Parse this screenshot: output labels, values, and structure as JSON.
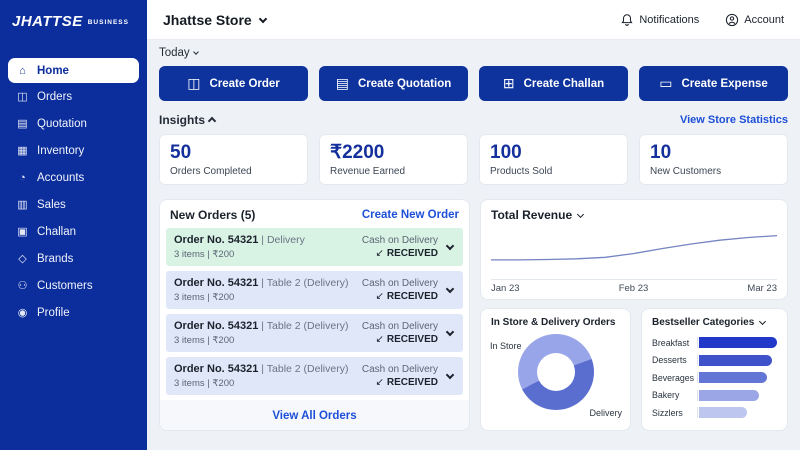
{
  "brand": {
    "logo_text": "JHATTSE",
    "logo_suffix": "BUSINESS"
  },
  "topbar": {
    "store_name": "Jhattse Store",
    "notifications_label": "Notifications",
    "account_label": "Account"
  },
  "sidebar": {
    "items": [
      {
        "label": "Home",
        "active": true
      },
      {
        "label": "Orders"
      },
      {
        "label": "Quotation"
      },
      {
        "label": "Inventory"
      },
      {
        "label": "Accounts"
      },
      {
        "label": "Sales"
      },
      {
        "label": "Challan"
      },
      {
        "label": "Brands"
      },
      {
        "label": "Customers"
      },
      {
        "label": "Profile"
      }
    ]
  },
  "icons": {
    "home": "⌂",
    "orders": "◫",
    "quotation": "▤",
    "inventory": "▦",
    "accounts": "◔",
    "sales": "▥",
    "challan": "▣",
    "brands": "◇",
    "customers": "⚇",
    "profile": "◉",
    "create_order": "◫",
    "create_quotation": "▤",
    "create_challan": "⊞",
    "create_expense": "▭"
  },
  "filters": {
    "period_label": "Today"
  },
  "actions": [
    {
      "label": "Create Order"
    },
    {
      "label": "Create Quotation"
    },
    {
      "label": "Create Challan"
    },
    {
      "label": "Create Expense"
    }
  ],
  "insights": {
    "title": "Insights",
    "stats_link": "View Store Statistics",
    "cards": [
      {
        "value": "50",
        "label": "Orders Completed"
      },
      {
        "value": "₹2200",
        "label": "Revenue Earned"
      },
      {
        "value": "100",
        "label": "Products Sold"
      },
      {
        "value": "10",
        "label": "New Customers"
      }
    ]
  },
  "new_orders": {
    "title": "New Orders (5)",
    "create_link": "Create New Order",
    "view_all": "View All Orders",
    "sep": "|",
    "status_arrow": "↙",
    "orders": [
      {
        "number": "Order No. 54321",
        "location": "Delivery",
        "items": "3 items | ₹200",
        "payment": "Cash on Delivery",
        "status": "RECEIVED",
        "highlight": "green"
      },
      {
        "number": "Order No. 54321",
        "location": "Table 2  (Delivery)",
        "items": "3 items | ₹200",
        "payment": "Cash on Delivery",
        "status": "RECEIVED",
        "highlight": "lavender"
      },
      {
        "number": "Order No. 54321",
        "location": "Table 2  (Delivery)",
        "items": "3 items | ₹200",
        "payment": "Cash on Delivery",
        "status": "RECEIVED",
        "highlight": "lavender"
      },
      {
        "number": "Order No. 54321",
        "location": "Table 2  (Delivery)",
        "items": "3 items | ₹200",
        "payment": "Cash on Delivery",
        "status": "RECEIVED",
        "highlight": "lavender"
      }
    ]
  },
  "chart_data": [
    {
      "type": "line",
      "title": "Total Revenue",
      "x_ticks": [
        "Jan 23",
        "Feb 23",
        "Mar 23"
      ],
      "x": [
        0,
        0.1,
        0.2,
        0.3,
        0.4,
        0.5,
        0.6,
        0.7,
        0.8,
        0.9,
        1
      ],
      "y": [
        16,
        16,
        17,
        19,
        23,
        33,
        46,
        58,
        68,
        75,
        80
      ],
      "note": "y values are relative 0-100; chart has no visible y-axis labels",
      "ylim": [
        0,
        100
      ],
      "color": "#7484c2",
      "grid": false,
      "legend": "none"
    },
    {
      "type": "pie",
      "title": "In Store & Delivery Orders",
      "labels": [
        "In Store",
        "Delivery"
      ],
      "values": [
        52,
        48
      ],
      "colors": [
        "#98a5e9",
        "#5a6ecf"
      ],
      "rotation_deg": 70,
      "donut": true
    },
    {
      "type": "bar",
      "orientation": "horizontal",
      "title": "Bestseller Categories",
      "categories": [
        "Breakfast",
        "Desserts",
        "Beverages",
        "Bakery",
        "Sizzlers"
      ],
      "values": [
        100,
        94,
        87,
        77,
        61
      ],
      "note": "values are relative bar lengths 0-100; no axis labels shown",
      "colors": [
        "#2138c8",
        "#3e53ca",
        "#6376d6",
        "#9aa6e5",
        "#bdc6ee"
      ],
      "xlim": [
        0,
        100
      ],
      "grid": false
    }
  ],
  "colors": {
    "sidebar_bg": "#0c2e9c",
    "button_bg": "#0e339c",
    "link_blue": "#1d4fd8",
    "stat_value_blue": "#14309c",
    "row_green": "#d8f2e4",
    "row_lavender": "#e0e7f9",
    "content_bg": "#eef1f6"
  }
}
